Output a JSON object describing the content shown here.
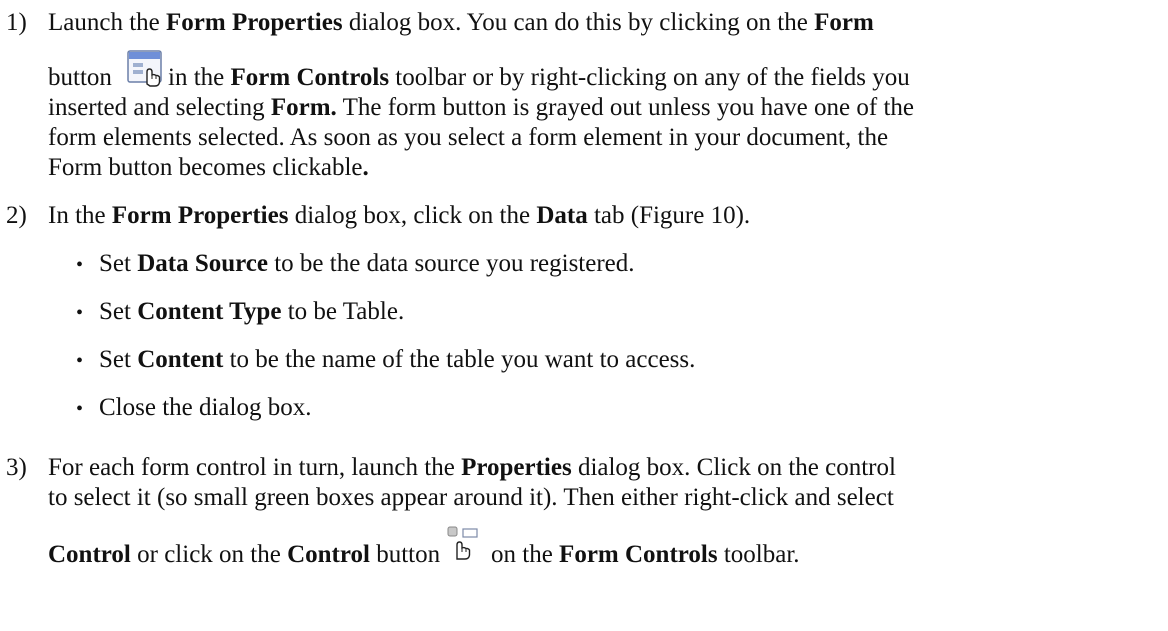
{
  "steps": [
    {
      "num": "1)",
      "lines": [
        [
          "Launch the ",
          "Form Properties",
          " dialog box. You can do this by clicking on the ",
          "Form"
        ],
        [
          "button",
          " in the ",
          "Form Controls",
          " toolbar or by right-clicking on any of the fields you"
        ],
        [
          "inserted and selecting ",
          "Form.",
          " The form button is grayed out unless you have one of the"
        ],
        [
          "form elements selected. As soon as you select a form element in your document, the"
        ],
        [
          "Form button becomes clickable",
          "."
        ]
      ]
    },
    {
      "num": "2)",
      "lines": [
        [
          "In the ",
          "Form Properties",
          " dialog box, click on the ",
          "Data",
          " tab (Figure 10)."
        ]
      ],
      "bullets": [
        [
          "Set ",
          "Data Source",
          " to be the data source you registered."
        ],
        [
          "Set ",
          "Content Type",
          " to be Table."
        ],
        [
          "Set ",
          "Content",
          " to be the name of the table you want to access."
        ],
        [
          "Close the dialog box."
        ]
      ]
    },
    {
      "num": "3)",
      "lines": [
        [
          "For each form control in turn, launch the ",
          "Properties",
          " dialog box. Click on the control"
        ],
        [
          "to select it (so small green boxes appear around it). Then either right-click and select"
        ],
        [
          "Control",
          " or click on the ",
          "Control",
          " button",
          " on the ",
          "Form Controls",
          " toolbar."
        ]
      ]
    }
  ],
  "bullet_glyph": "•",
  "icons": {
    "form": "form-properties-icon",
    "control": "control-properties-icon"
  }
}
